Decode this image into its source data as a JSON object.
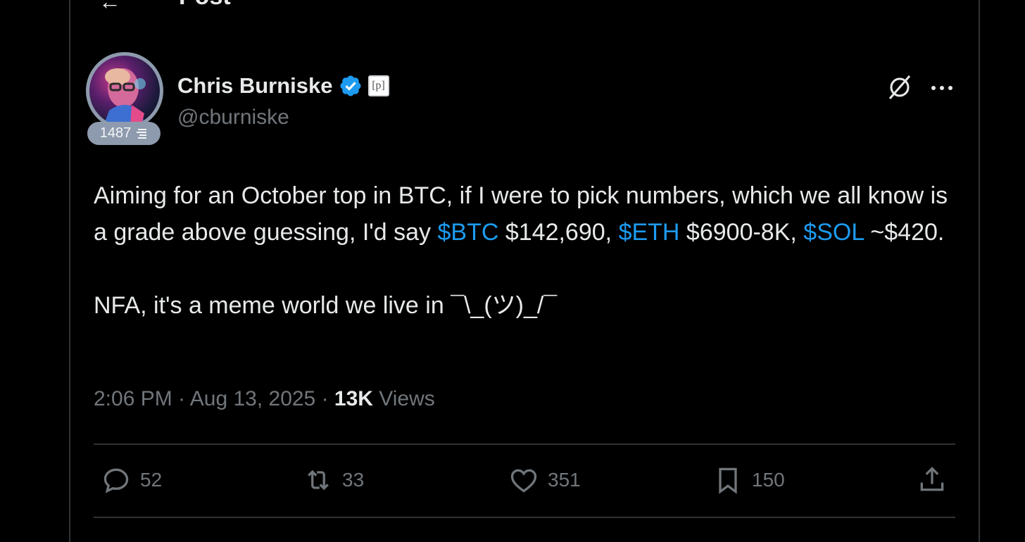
{
  "header": {
    "title": "Post",
    "back_icon": "back-arrow-icon",
    "reader_icon": "reader-icon"
  },
  "author": {
    "display_name": "Chris Burniske",
    "handle": "@cburniske",
    "verified": true,
    "affiliate_badge": "[p]",
    "badge_count": "1487"
  },
  "tweet": {
    "line1_prefix": "Aiming for an October top in BTC, if I were to pick numbers, which we all know is a grade above guessing, I'd say ",
    "cashtag_btc": "$BTC",
    "btc_value": " $142,690, ",
    "cashtag_eth": "$ETH",
    "eth_value": " $6900-8K, ",
    "cashtag_sol": "$SOL",
    "sol_value": " ~$420.",
    "paragraph2": "NFA, it's a meme world we live in ¯\\_(ツ)_/¯"
  },
  "meta": {
    "time": "2:06 PM",
    "sep": " · ",
    "date": "Aug 13, 2025",
    "views_count": "13K",
    "views_label": " Views"
  },
  "actions": {
    "replies": "52",
    "reposts": "33",
    "likes": "351",
    "bookmarks": "150"
  },
  "colors": {
    "background": "#000000",
    "text": "#e7e9ea",
    "muted": "#71767b",
    "accent": "#1d9bf0",
    "border": "#2f3336"
  }
}
